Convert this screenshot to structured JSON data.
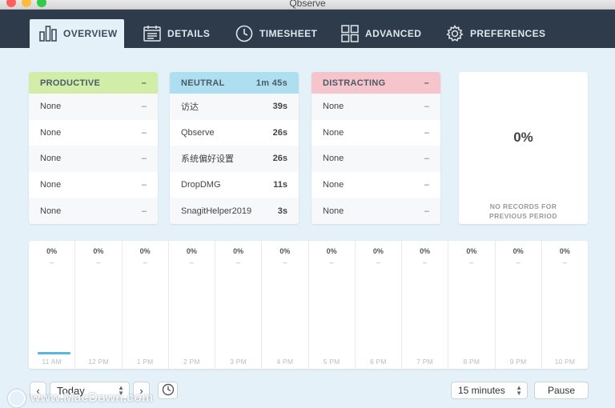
{
  "window": {
    "title": "Qbserve"
  },
  "tabs": [
    {
      "label": "OVERVIEW",
      "icon": "bar-chart-icon",
      "active": true
    },
    {
      "label": "DETAILS",
      "icon": "calendar-list-icon",
      "active": false
    },
    {
      "label": "TIMESHEET",
      "icon": "clock-icon",
      "active": false
    },
    {
      "label": "ADVANCED",
      "icon": "grid-icon",
      "active": false
    },
    {
      "label": "PREFERENCES",
      "icon": "gear-icon",
      "active": false
    }
  ],
  "productive": {
    "title": "PRODUCTIVE",
    "total": "–",
    "rows": [
      {
        "name": "None",
        "value": "–"
      },
      {
        "name": "None",
        "value": "–"
      },
      {
        "name": "None",
        "value": "–"
      },
      {
        "name": "None",
        "value": "–"
      },
      {
        "name": "None",
        "value": "–"
      }
    ]
  },
  "neutral": {
    "title": "NEUTRAL",
    "total": "1m 45s",
    "rows": [
      {
        "name": "访达",
        "value": "39s"
      },
      {
        "name": "Qbserve",
        "value": "26s"
      },
      {
        "name": "系统偏好设置",
        "value": "26s"
      },
      {
        "name": "DropDMG",
        "value": "11s"
      },
      {
        "name": "SnagitHelper2019",
        "value": "3s"
      }
    ]
  },
  "distracting": {
    "title": "DISTRACTING",
    "total": "–",
    "rows": [
      {
        "name": "None",
        "value": "–"
      },
      {
        "name": "None",
        "value": "–"
      },
      {
        "name": "None",
        "value": "–"
      },
      {
        "name": "None",
        "value": "–"
      },
      {
        "name": "None",
        "value": "–"
      }
    ]
  },
  "summary": {
    "percent": "0%",
    "note": "NO RECORDS FOR PREVIOUS PERIOD"
  },
  "timeline": [
    {
      "percent": "0%",
      "sub": "–",
      "time": "11 AM",
      "activity": 0.75
    },
    {
      "percent": "0%",
      "sub": "–",
      "time": "12 PM",
      "activity": 0
    },
    {
      "percent": "0%",
      "sub": "–",
      "time": "1 PM",
      "activity": 0
    },
    {
      "percent": "0%",
      "sub": "–",
      "time": "2 PM",
      "activity": 0
    },
    {
      "percent": "0%",
      "sub": "–",
      "time": "3 PM",
      "activity": 0
    },
    {
      "percent": "0%",
      "sub": "–",
      "time": "4 PM",
      "activity": 0
    },
    {
      "percent": "0%",
      "sub": "–",
      "time": "5 PM",
      "activity": 0
    },
    {
      "percent": "0%",
      "sub": "–",
      "time": "6 PM",
      "activity": 0
    },
    {
      "percent": "0%",
      "sub": "–",
      "time": "7 PM",
      "activity": 0
    },
    {
      "percent": "0%",
      "sub": "–",
      "time": "8 PM",
      "activity": 0
    },
    {
      "percent": "0%",
      "sub": "–",
      "time": "9 PM",
      "activity": 0
    },
    {
      "percent": "0%",
      "sub": "–",
      "time": "10 PM",
      "activity": 0
    }
  ],
  "controls": {
    "prev": "‹",
    "next": "›",
    "day": "Today",
    "interval": "15 minutes",
    "pause": "Pause"
  },
  "watermark": {
    "text": "www.MacDown.com"
  },
  "colors": {
    "productive": "#d2eda8",
    "neutral": "#aedff0",
    "distracting": "#f6c5cb",
    "toolbar": "#2e3b4a",
    "activity_bar": "#56b8de"
  }
}
